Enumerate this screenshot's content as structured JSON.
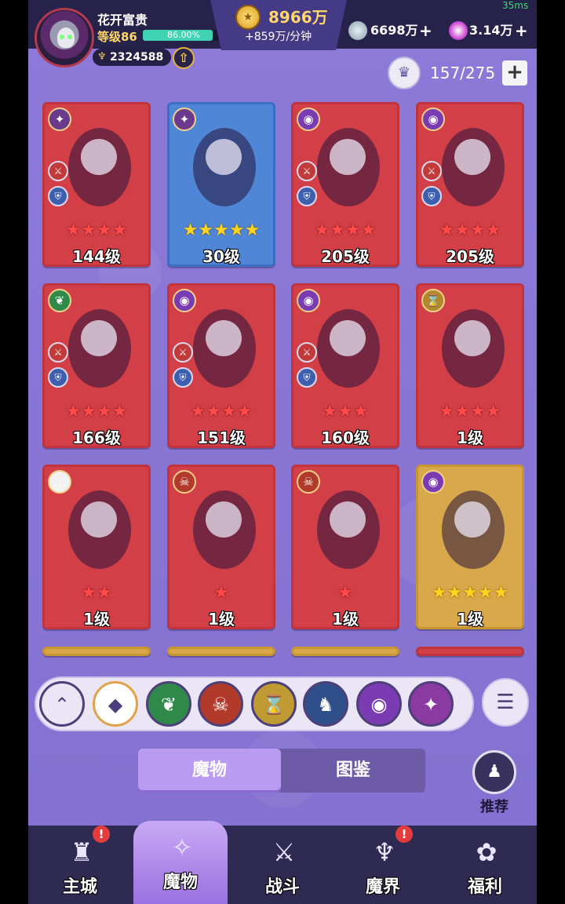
{
  "status": {
    "ping": "35ms"
  },
  "player": {
    "name": "花开富贵",
    "level": "等级86",
    "xp_percent_label": "86.00%",
    "xp_fraction": 0.86,
    "power": "2324588"
  },
  "resources": {
    "gold": "8966万",
    "gold_rate": "+859万/分钟",
    "silver": "6698万",
    "crystal": "3.14万"
  },
  "roster": {
    "count": "157/275"
  },
  "cards": [
    {
      "level": "144级",
      "stars": "★★★★",
      "star_color": "red",
      "frame": "red",
      "faction_icon": "sun-swirl-icon",
      "faction_glyph": "✦",
      "faction_color": "#6b3a8c",
      "has_badges": true
    },
    {
      "level": "30级",
      "stars": "★★★★★",
      "star_color": "gold",
      "frame": "blue",
      "faction_icon": "sun-swirl-icon",
      "faction_glyph": "✦",
      "faction_color": "#6b3a8c",
      "has_badges": false
    },
    {
      "level": "205级",
      "stars": "★★★★",
      "star_color": "red",
      "frame": "red",
      "faction_icon": "eye-icon",
      "faction_glyph": "◉",
      "faction_color": "#7b3bb2",
      "has_badges": true
    },
    {
      "level": "205级",
      "stars": "★★★★",
      "star_color": "red",
      "frame": "red",
      "faction_icon": "eye-icon",
      "faction_glyph": "◉",
      "faction_color": "#7b3bb2",
      "has_badges": true
    },
    {
      "level": "166级",
      "stars": "★★★★",
      "star_color": "red",
      "frame": "red",
      "faction_icon": "leaf-icon",
      "faction_glyph": "❦",
      "faction_color": "#2f8a4a",
      "has_badges": true
    },
    {
      "level": "151级",
      "stars": "★★★★",
      "star_color": "red",
      "frame": "red",
      "faction_icon": "eye-icon",
      "faction_glyph": "◉",
      "faction_color": "#7b3bb2",
      "has_badges": true
    },
    {
      "level": "160级",
      "stars": "★★★",
      "star_color": "red",
      "frame": "red",
      "faction_icon": "eye-icon",
      "faction_glyph": "◉",
      "faction_color": "#7b3bb2",
      "has_badges": true
    },
    {
      "level": "1级",
      "stars": "★★★★",
      "star_color": "red",
      "frame": "red",
      "faction_icon": "hourglass-icon",
      "faction_glyph": "⌛",
      "faction_color": "#b08a2a",
      "has_badges": false
    },
    {
      "level": "1级",
      "stars": "★★",
      "star_color": "red",
      "frame": "red",
      "faction_icon": "chat-bubble-icon",
      "faction_glyph": "…",
      "faction_color": "#f2f2f2",
      "has_badges": false
    },
    {
      "level": "1级",
      "stars": "★",
      "star_color": "red",
      "frame": "red",
      "faction_icon": "demon-mask-icon",
      "faction_glyph": "☠",
      "faction_color": "#b23a2a",
      "has_badges": false
    },
    {
      "level": "1级",
      "stars": "★",
      "star_color": "red",
      "frame": "red",
      "faction_icon": "demon-mask-icon",
      "faction_glyph": "☠",
      "faction_color": "#b23a2a",
      "has_badges": false
    },
    {
      "level": "1级",
      "stars": "★★★★★",
      "star_color": "gold",
      "frame": "gold",
      "faction_icon": "eye-icon",
      "faction_glyph": "◉",
      "faction_color": "#7b3bb2",
      "has_badges": false
    }
  ],
  "filters": [
    {
      "name": "collapse-filters-button",
      "glyph": "⌃",
      "color": "#eae6f6",
      "fg": "#4c3f7a"
    },
    {
      "name": "filter-all-button",
      "glyph": "◆",
      "color": "#ffffff",
      "fg": "#4c3f7a"
    },
    {
      "name": "filter-nature-button",
      "glyph": "❦",
      "color": "#2f8a4a",
      "fg": "#ffffff"
    },
    {
      "name": "filter-demon-button",
      "glyph": "☠",
      "color": "#b23a2a",
      "fg": "#ffffff"
    },
    {
      "name": "filter-time-button",
      "glyph": "⌛",
      "color": "#c09a32",
      "fg": "#ffffff"
    },
    {
      "name": "filter-dragon-button",
      "glyph": "♞",
      "color": "#2f4f8a",
      "fg": "#ffffff"
    },
    {
      "name": "filter-eye-button",
      "glyph": "◉",
      "color": "#7b3bb2",
      "fg": "#ffffff"
    },
    {
      "name": "filter-swirl-button",
      "glyph": "✦",
      "color": "#8a3aa0",
      "fg": "#ffffff"
    }
  ],
  "tabs": {
    "monsters": "魔物",
    "codex": "图鉴"
  },
  "recommend": {
    "label": "推荐"
  },
  "nav": [
    {
      "label": "主城",
      "icon": "castle-icon",
      "glyph": "♜",
      "notify": true
    },
    {
      "label": "魔物",
      "icon": "monster-flame-icon",
      "glyph": "✧",
      "notify": false
    },
    {
      "label": "战斗",
      "icon": "sword-shield-icon",
      "glyph": "⚔",
      "notify": false
    },
    {
      "label": "魔界",
      "icon": "portal-icon",
      "glyph": "♆",
      "notify": true
    },
    {
      "label": "福利",
      "icon": "gift-chest-icon",
      "glyph": "✿",
      "notify": false
    }
  ],
  "notif_mark": "!",
  "colors": {
    "accent": "#b99cf2",
    "card_red": "#d23f47",
    "gold_text": "#ffd76a"
  }
}
